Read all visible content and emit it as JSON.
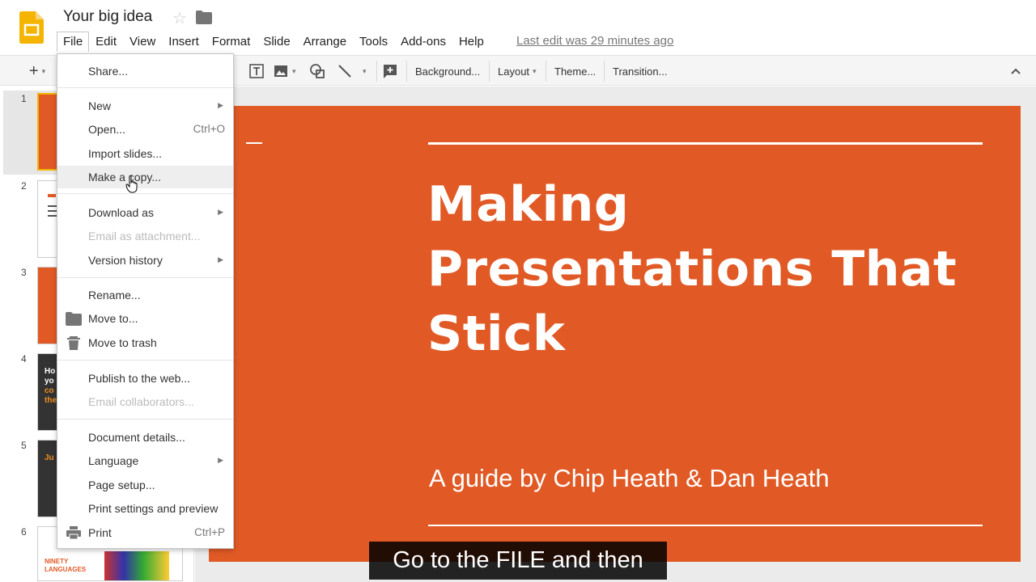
{
  "app": {
    "title": "Your big idea",
    "last_edit": "Last edit was 29 minutes ago"
  },
  "menubar": [
    "File",
    "Edit",
    "View",
    "Insert",
    "Format",
    "Slide",
    "Arrange",
    "Tools",
    "Add-ons",
    "Help"
  ],
  "toolbar": {
    "new_slide_icon": "plus-icon",
    "background": "Background...",
    "layout": "Layout",
    "theme": "Theme...",
    "transition": "Transition..."
  },
  "file_menu": {
    "share": "Share...",
    "new": "New",
    "open": "Open...",
    "open_shortcut": "Ctrl+O",
    "import_slides": "Import slides...",
    "make_copy": "Make a copy...",
    "download_as": "Download as",
    "email_attachment": "Email as attachment...",
    "version_history": "Version history",
    "rename": "Rename...",
    "move_to": "Move to...",
    "move_to_trash": "Move to trash",
    "publish": "Publish to the web...",
    "email_collaborators": "Email collaborators...",
    "document_details": "Document details...",
    "language": "Language",
    "page_setup": "Page setup...",
    "print_settings": "Print settings and preview",
    "print": "Print",
    "print_shortcut": "Ctrl+P"
  },
  "filmstrip": {
    "numbers": [
      "1",
      "2",
      "3",
      "4",
      "5",
      "6"
    ],
    "slide4_text": [
      "Ho",
      "yo",
      "co",
      "the"
    ],
    "slide5_text": [
      "Ju"
    ],
    "slide6_text": [
      "NINETY",
      "LANGUAGES"
    ]
  },
  "slide": {
    "title_lines": [
      "Making",
      "Presentations That",
      "Stick"
    ],
    "subtitle": "A guide by Chip Heath & Dan Heath"
  },
  "caption": "Go to the FILE and then",
  "colors": {
    "slide_orange": "#e15a26",
    "menu_hover": "#eeeeee"
  }
}
